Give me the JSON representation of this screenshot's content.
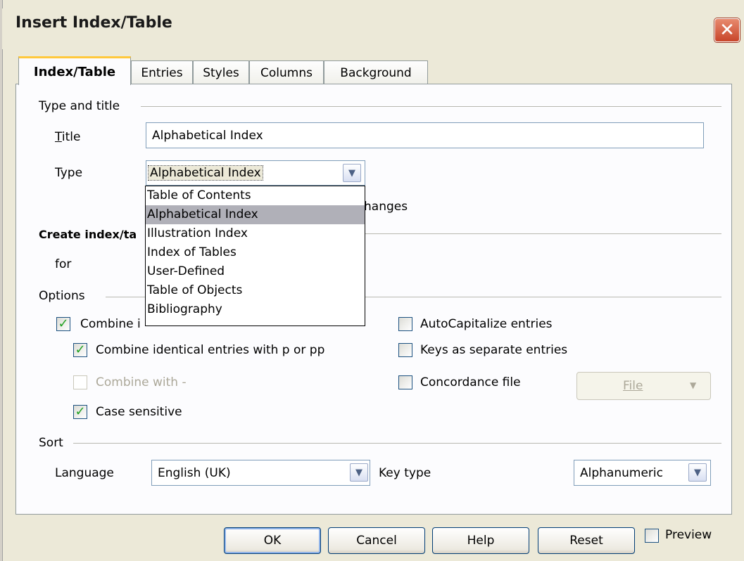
{
  "window": {
    "title": "Insert Index/Table",
    "close_glyph": "✕"
  },
  "tabs": [
    {
      "label": "Index/Table",
      "active": true
    },
    {
      "label": "Entries"
    },
    {
      "label": "Styles"
    },
    {
      "label": "Columns"
    },
    {
      "label": "Background"
    }
  ],
  "type_and_title": {
    "heading": "Type and title",
    "title_label": "Title",
    "title_value": "Alphabetical Index",
    "type_label": "Type",
    "type_value": "Alphabetical Index",
    "protect_suffix": "hanges"
  },
  "type_dropdown": {
    "options": [
      "Table of Contents",
      "Alphabetical Index",
      "Illustration Index",
      "Index of Tables",
      "User-Defined",
      "Table of Objects",
      "Bibliography"
    ],
    "selected": "Alphabetical Index"
  },
  "create_index": {
    "heading_prefix": "Create index/ta",
    "for_label": "for"
  },
  "options": {
    "heading": "Options",
    "combine_identical_prefix": "Combine i",
    "combine_identical_checked": true,
    "combine_p_pp": "Combine identical entries with p or pp",
    "combine_p_pp_checked": true,
    "combine_with": "Combine with -",
    "combine_with_checked": false,
    "case_sensitive": "Case sensitive",
    "case_sensitive_checked": true,
    "autocapitalize": "AutoCapitalize entries",
    "autocapitalize_checked": false,
    "keys_separate": "Keys as separate entries",
    "keys_separate_checked": false,
    "concordance": "Concordance file",
    "concordance_checked": false,
    "file_button": "File",
    "check_glyph": "✓"
  },
  "sort": {
    "heading": "Sort",
    "language_label": "Language",
    "language_value": "English (UK)",
    "key_type_label": "Key type",
    "key_type_value": "Alphanumeric"
  },
  "buttons": {
    "ok": "OK",
    "cancel": "Cancel",
    "help": "Help",
    "reset": "Reset"
  },
  "preview": {
    "label": "Preview",
    "checked": false
  },
  "icons": {
    "dropdown_arrow": "▼"
  },
  "colors": {
    "tab_highlight": "#ffc83c",
    "check": "#21a121",
    "close": "#c8452a",
    "panel": "#fcfcfe",
    "dialog": "#ece9d8"
  }
}
